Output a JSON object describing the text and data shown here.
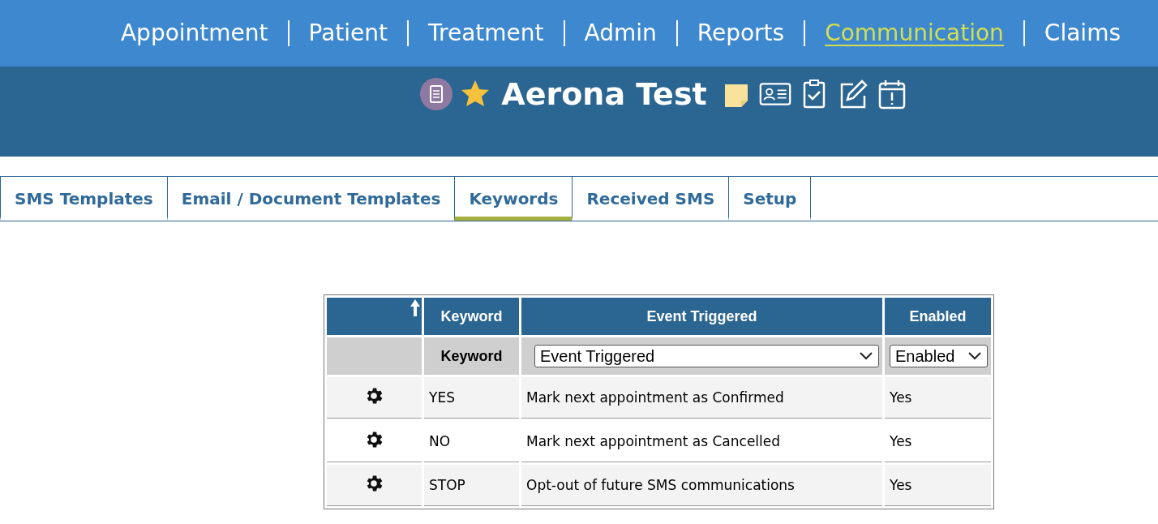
{
  "nav": [
    {
      "label": "Appointment",
      "selected": false
    },
    {
      "label": "Patient",
      "selected": false
    },
    {
      "label": "Treatment",
      "selected": false
    },
    {
      "label": "Admin",
      "selected": false
    },
    {
      "label": "Reports",
      "selected": false
    },
    {
      "label": "Communication",
      "selected": true
    },
    {
      "label": "Claims",
      "selected": false
    }
  ],
  "patient": {
    "name": "Aerona Test"
  },
  "tabs": [
    {
      "label": "SMS Templates",
      "selected": false
    },
    {
      "label": "Email / Document Templates",
      "selected": false
    },
    {
      "label": "Keywords",
      "selected": true
    },
    {
      "label": "Received SMS",
      "selected": false
    },
    {
      "label": "Setup",
      "selected": false
    }
  ],
  "table": {
    "columns": [
      "Keyword",
      "Event Triggered",
      "Enabled"
    ],
    "filters": {
      "keyword": "Keyword",
      "event": "Event Triggered",
      "enabled": "Enabled"
    },
    "rows": [
      {
        "keyword": "YES",
        "event": "Mark next appointment as Confirmed",
        "enabled": "Yes"
      },
      {
        "keyword": "NO",
        "event": "Mark next appointment as Cancelled",
        "enabled": "Yes"
      },
      {
        "keyword": "STOP",
        "event": "Opt-out of future SMS communications",
        "enabled": "Yes"
      }
    ]
  }
}
